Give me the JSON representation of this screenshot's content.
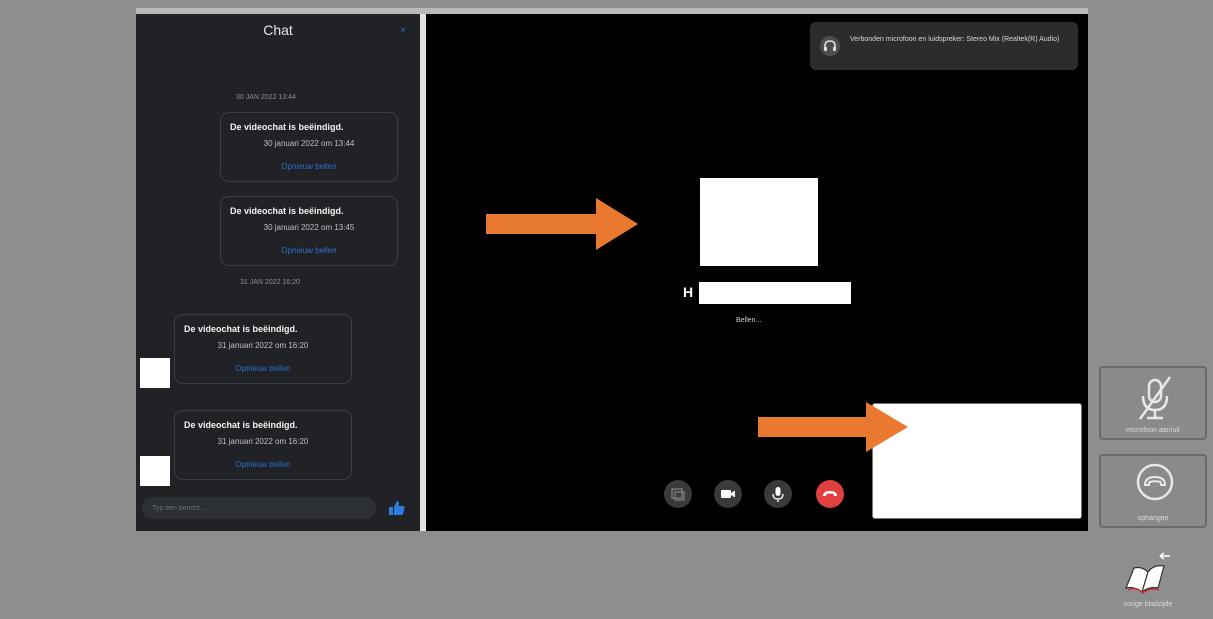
{
  "chat": {
    "title": "Chat",
    "close_glyph": "×",
    "messages": [
      {
        "date_separator": "30 JAN 2022 13:44",
        "title": "De videochat is beëindigd.",
        "date": "30 januari 2022 om 13:44",
        "link": "Opnieuw bellen"
      },
      {
        "title": "De videochat is beëindigd.",
        "date": "30 januari 2022 om 13:45",
        "link": "Opnieuw bellen"
      },
      {
        "date_separator": "31 JAN 2022 16:20",
        "title": "De videochat is beëindigd.",
        "date": "31 januari 2022 om 16:20",
        "link": "Opnieuw bellen"
      },
      {
        "title": "De videochat is beëindigd.",
        "date": "31 januari 2022 om 16:20",
        "link": "Opnieuw bellen"
      }
    ],
    "input_placeholder": "Typ een bericht...",
    "like_icon": "thumbs-up-icon"
  },
  "notification": {
    "text": "Verbonden microfoon en luidspreker: Stereo Mix (Realtek(R) Audio)",
    "icon": "headphones-icon"
  },
  "call": {
    "caller_initial": "H",
    "status": "Bellen..."
  },
  "controls": [
    "screen-share-icon",
    "camera-icon",
    "microphone-icon",
    "hang-up-icon"
  ],
  "side_buttons": {
    "mute_label": "microfoon aan/uit",
    "hangup_label": "ophangen",
    "guestbook_label": "vorige bladzijde"
  },
  "colors": {
    "arrow": "#e8792f",
    "accent_blue": "#2b6fd0",
    "end_call_red": "#e04040"
  }
}
